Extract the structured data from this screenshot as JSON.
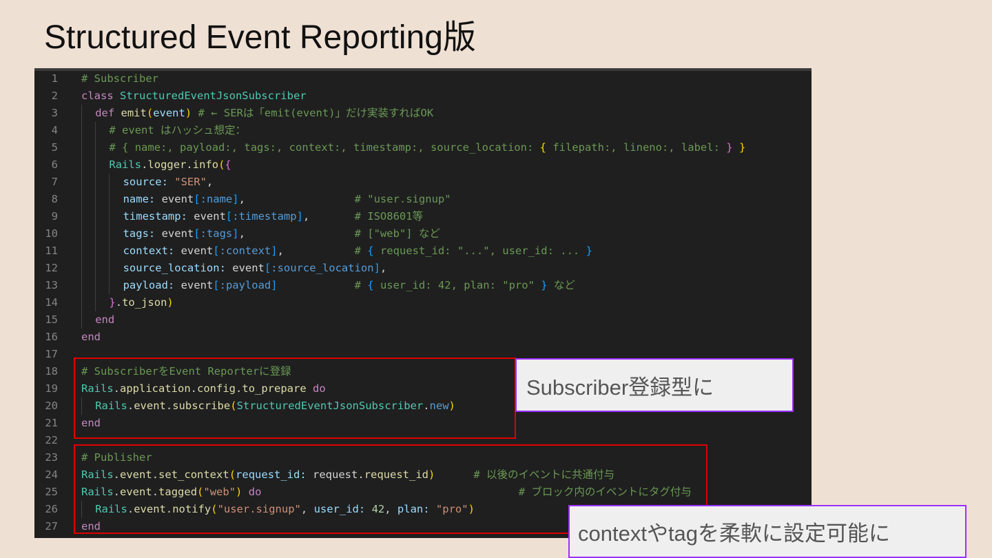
{
  "slide": {
    "title": "Structured Event Reporting版"
  },
  "callouts": {
    "subscriber": "Subscriber登録型に",
    "context": "contextやtagを柔軟に設定可能に"
  },
  "code_lines": [
    {
      "n": "1",
      "indent": 0,
      "tokens": [
        [
          "# Subscriber",
          "c-comment"
        ]
      ]
    },
    {
      "n": "2",
      "indent": 0,
      "tokens": [
        [
          "class ",
          "c-kw"
        ],
        [
          "StructuredEventJsonSubscriber",
          "c-class"
        ]
      ]
    },
    {
      "n": "3",
      "indent": 1,
      "tokens": [
        [
          "def ",
          "c-kw"
        ],
        [
          "emit",
          "c-fn"
        ],
        [
          "(",
          "c-b1"
        ],
        [
          "event",
          "c-var"
        ],
        [
          ")",
          "c-b1"
        ],
        [
          " # ← SERは「emit(event)」だけ実装すればOK",
          "c-comment"
        ]
      ]
    },
    {
      "n": "4",
      "indent": 2,
      "tokens": [
        [
          "# event はハッシュ想定：",
          "c-comment"
        ]
      ]
    },
    {
      "n": "5",
      "indent": 2,
      "tokens": [
        [
          "# { name:, payload:, tags:, context:, timestamp:, source_location: ",
          "c-comment"
        ],
        [
          "{",
          "c-b1"
        ],
        [
          " filepath:, lineno:, label: ",
          "c-comment"
        ],
        [
          "}",
          "c-b2"
        ],
        [
          " ",
          "c-comment"
        ],
        [
          "}",
          "c-b1"
        ]
      ]
    },
    {
      "n": "6",
      "indent": 2,
      "tokens": [
        [
          "Rails",
          "c-class"
        ],
        [
          ".",
          "c-plain"
        ],
        [
          "logger",
          "c-fn"
        ],
        [
          ".",
          "c-plain"
        ],
        [
          "info",
          "c-fn"
        ],
        [
          "(",
          "c-b1"
        ],
        [
          "{",
          "c-b2"
        ]
      ]
    },
    {
      "n": "7",
      "indent": 3,
      "tokens": [
        [
          "source: ",
          "c-var"
        ],
        [
          "\"SER\"",
          "c-str"
        ],
        [
          ",",
          "c-plain"
        ]
      ]
    },
    {
      "n": "8",
      "indent": 3,
      "tokens": [
        [
          "name: ",
          "c-var"
        ],
        [
          "event",
          "c-plain"
        ],
        [
          "[",
          "c-b3"
        ],
        [
          ":name",
          "c-sym"
        ],
        [
          "]",
          "c-b3"
        ],
        [
          ",                 ",
          "c-plain"
        ],
        [
          "# \"user.signup\"",
          "c-comment"
        ]
      ]
    },
    {
      "n": "9",
      "indent": 3,
      "tokens": [
        [
          "timestamp: ",
          "c-var"
        ],
        [
          "event",
          "c-plain"
        ],
        [
          "[",
          "c-b3"
        ],
        [
          ":timestamp",
          "c-sym"
        ],
        [
          "]",
          "c-b3"
        ],
        [
          ",       ",
          "c-plain"
        ],
        [
          "# ISO8601等",
          "c-comment"
        ]
      ]
    },
    {
      "n": "10",
      "indent": 3,
      "tokens": [
        [
          "tags: ",
          "c-var"
        ],
        [
          "event",
          "c-plain"
        ],
        [
          "[",
          "c-b3"
        ],
        [
          ":tags",
          "c-sym"
        ],
        [
          "]",
          "c-b3"
        ],
        [
          ",                 ",
          "c-plain"
        ],
        [
          "# [\"web\"] など",
          "c-comment"
        ]
      ]
    },
    {
      "n": "11",
      "indent": 3,
      "tokens": [
        [
          "context: ",
          "c-var"
        ],
        [
          "event",
          "c-plain"
        ],
        [
          "[",
          "c-b3"
        ],
        [
          ":context",
          "c-sym"
        ],
        [
          "]",
          "c-b3"
        ],
        [
          ",           ",
          "c-plain"
        ],
        [
          "# ",
          "c-comment"
        ],
        [
          "{",
          "c-b3"
        ],
        [
          " request_id: \"...\", user_id: ... ",
          "c-comment"
        ],
        [
          "}",
          "c-b3"
        ]
      ]
    },
    {
      "n": "12",
      "indent": 3,
      "tokens": [
        [
          "source_location: ",
          "c-var"
        ],
        [
          "event",
          "c-plain"
        ],
        [
          "[",
          "c-b3"
        ],
        [
          ":source_location",
          "c-sym"
        ],
        [
          "]",
          "c-b3"
        ],
        [
          ",",
          "c-plain"
        ]
      ]
    },
    {
      "n": "13",
      "indent": 3,
      "tokens": [
        [
          "payload: ",
          "c-var"
        ],
        [
          "event",
          "c-plain"
        ],
        [
          "[",
          "c-b3"
        ],
        [
          ":payload",
          "c-sym"
        ],
        [
          "]",
          "c-b3"
        ],
        [
          "            ",
          "c-plain"
        ],
        [
          "# ",
          "c-comment"
        ],
        [
          "{",
          "c-b3"
        ],
        [
          " user_id: 42, plan: \"pro\" ",
          "c-comment"
        ],
        [
          "}",
          "c-b3"
        ],
        [
          " など",
          "c-comment"
        ]
      ]
    },
    {
      "n": "14",
      "indent": 2,
      "tokens": [
        [
          "}",
          "c-b2"
        ],
        [
          ".",
          "c-plain"
        ],
        [
          "to_json",
          "c-fn"
        ],
        [
          ")",
          "c-b1"
        ]
      ]
    },
    {
      "n": "15",
      "indent": 1,
      "tokens": [
        [
          "end",
          "c-kw"
        ]
      ]
    },
    {
      "n": "16",
      "indent": 0,
      "tokens": [
        [
          "end",
          "c-kw"
        ]
      ]
    },
    {
      "n": "17",
      "indent": 0,
      "tokens": []
    },
    {
      "n": "18",
      "indent": 0,
      "tokens": [
        [
          "# SubscriberをEvent Reporterに登録",
          "c-comment"
        ]
      ]
    },
    {
      "n": "19",
      "indent": 0,
      "tokens": [
        [
          "Rails",
          "c-class"
        ],
        [
          ".",
          "c-plain"
        ],
        [
          "application",
          "c-fn"
        ],
        [
          ".",
          "c-plain"
        ],
        [
          "config",
          "c-fn"
        ],
        [
          ".",
          "c-plain"
        ],
        [
          "to_prepare ",
          "c-fn"
        ],
        [
          "do",
          "c-kw"
        ]
      ]
    },
    {
      "n": "20",
      "indent": 1,
      "tokens": [
        [
          "Rails",
          "c-class"
        ],
        [
          ".",
          "c-plain"
        ],
        [
          "event",
          "c-fn"
        ],
        [
          ".",
          "c-plain"
        ],
        [
          "subscribe",
          "c-fn"
        ],
        [
          "(",
          "c-b1"
        ],
        [
          "StructuredEventJsonSubscriber",
          "c-class"
        ],
        [
          ".",
          "c-plain"
        ],
        [
          "new",
          "c-sym"
        ],
        [
          ")",
          "c-b1"
        ]
      ]
    },
    {
      "n": "21",
      "indent": 0,
      "tokens": [
        [
          "end",
          "c-kw"
        ]
      ]
    },
    {
      "n": "22",
      "indent": 0,
      "tokens": []
    },
    {
      "n": "23",
      "indent": 0,
      "tokens": [
        [
          "# Publisher",
          "c-comment"
        ]
      ]
    },
    {
      "n": "24",
      "indent": 0,
      "tokens": [
        [
          "Rails",
          "c-class"
        ],
        [
          ".",
          "c-plain"
        ],
        [
          "event",
          "c-fn"
        ],
        [
          ".",
          "c-plain"
        ],
        [
          "set_context",
          "c-fn"
        ],
        [
          "(",
          "c-b1"
        ],
        [
          "request_id: ",
          "c-var"
        ],
        [
          "request",
          "c-plain"
        ],
        [
          ".",
          "c-plain"
        ],
        [
          "request_id",
          "c-fn"
        ],
        [
          ")",
          "c-b1"
        ],
        [
          "      ",
          "c-plain"
        ],
        [
          "# 以後のイベントに共通付与",
          "c-comment"
        ]
      ]
    },
    {
      "n": "25",
      "indent": 0,
      "tokens": [
        [
          "Rails",
          "c-class"
        ],
        [
          ".",
          "c-plain"
        ],
        [
          "event",
          "c-fn"
        ],
        [
          ".",
          "c-plain"
        ],
        [
          "tagged",
          "c-fn"
        ],
        [
          "(",
          "c-b1"
        ],
        [
          "\"web\"",
          "c-str"
        ],
        [
          ")",
          "c-b1"
        ],
        [
          " ",
          "c-plain"
        ],
        [
          "do",
          "c-kw"
        ],
        [
          "                                        ",
          "c-plain"
        ],
        [
          "# ブロック内のイベントにタグ付与",
          "c-comment"
        ]
      ]
    },
    {
      "n": "26",
      "indent": 1,
      "tokens": [
        [
          "Rails",
          "c-class"
        ],
        [
          ".",
          "c-plain"
        ],
        [
          "event",
          "c-fn"
        ],
        [
          ".",
          "c-plain"
        ],
        [
          "notify",
          "c-fn"
        ],
        [
          "(",
          "c-b1"
        ],
        [
          "\"user.signup\"",
          "c-str"
        ],
        [
          ", ",
          "c-plain"
        ],
        [
          "user_id: ",
          "c-var"
        ],
        [
          "42",
          "c-num"
        ],
        [
          ", ",
          "c-plain"
        ],
        [
          "plan: ",
          "c-var"
        ],
        [
          "\"pro\"",
          "c-str"
        ],
        [
          ")",
          "c-b1"
        ]
      ]
    },
    {
      "n": "27",
      "indent": 0,
      "tokens": [
        [
          "end",
          "c-kw"
        ]
      ]
    }
  ]
}
